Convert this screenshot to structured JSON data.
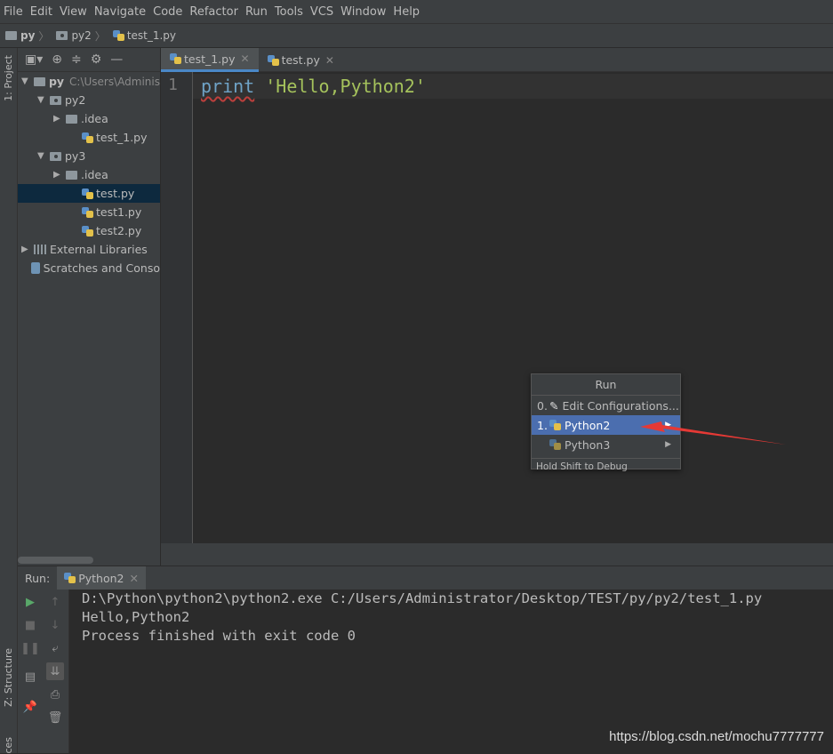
{
  "menu": [
    "File",
    "Edit",
    "View",
    "Navigate",
    "Code",
    "Refactor",
    "Run",
    "Tools",
    "VCS",
    "Window",
    "Help"
  ],
  "breadcrumb": [
    "py",
    "py2",
    "test_1.py"
  ],
  "left_strip": {
    "project_tab": "1: Project",
    "structure_tab": "Z: Structure",
    "bottom_cut": "ces"
  },
  "project_tree": [
    {
      "label": "py",
      "extra": "C:\\Users\\Adminis",
      "indent": 0,
      "arrow": "down",
      "icon": "folder"
    },
    {
      "label": "py2",
      "extra": "",
      "indent": 1,
      "arrow": "down",
      "icon": "folder"
    },
    {
      "label": ".idea",
      "extra": "",
      "indent": 2,
      "arrow": "right",
      "icon": "folder"
    },
    {
      "label": "test_1.py",
      "extra": "",
      "indent": 3,
      "arrow": "",
      "icon": "py"
    },
    {
      "label": "py3",
      "extra": "",
      "indent": 1,
      "arrow": "down",
      "icon": "folder"
    },
    {
      "label": ".idea",
      "extra": "",
      "indent": 2,
      "arrow": "right",
      "icon": "folder"
    },
    {
      "label": "test.py",
      "extra": "",
      "indent": 3,
      "arrow": "",
      "icon": "py",
      "selected": true
    },
    {
      "label": "test1.py",
      "extra": "",
      "indent": 3,
      "arrow": "",
      "icon": "py"
    },
    {
      "label": "test2.py",
      "extra": "",
      "indent": 3,
      "arrow": "",
      "icon": "py"
    },
    {
      "label": "External Libraries",
      "extra": "",
      "indent": 0,
      "arrow": "right",
      "icon": "lib"
    },
    {
      "label": "Scratches and Conso",
      "extra": "",
      "indent": 0,
      "arrow": "",
      "icon": "scratch"
    }
  ],
  "tabs": [
    {
      "label": "test_1.py",
      "active": true
    },
    {
      "label": "test.py",
      "active": false
    }
  ],
  "editor": {
    "line_number": "1",
    "keyword": "print",
    "string": "'Hello,Python2'"
  },
  "run_popup": {
    "title": "Run",
    "items": [
      {
        "num": "0.",
        "label": "Edit Configurations...",
        "selected": false,
        "icon": "pencil",
        "submenu": false
      },
      {
        "num": "1.",
        "label": "Python2",
        "selected": true,
        "icon": "python",
        "submenu": true
      },
      {
        "num": "",
        "label": "Python3",
        "selected": false,
        "icon": "python",
        "submenu": true
      }
    ],
    "hint": "Hold Shift to Debug"
  },
  "run_panel": {
    "label": "Run:",
    "tab": "Python2"
  },
  "console": [
    "D:\\Python\\python2\\python2.exe C:/Users/Administrator/Desktop/TEST/py/py2/test_1.py",
    "Hello,Python2",
    "",
    "Process finished with exit code 0"
  ],
  "watermark": "https://blog.csdn.net/mochu7777777",
  "colors": {
    "selection": "#0d293e",
    "popup_selection": "#4b6eaf",
    "keyword": "#6fa3c7",
    "string": "#a5c25c",
    "arrow": "#e53935"
  }
}
